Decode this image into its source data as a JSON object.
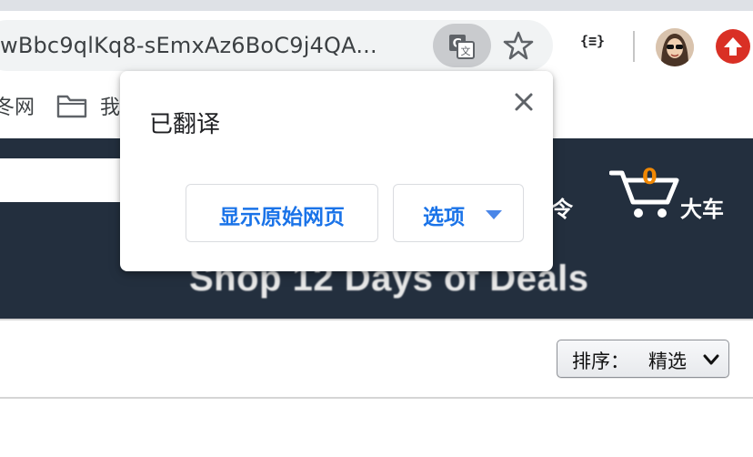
{
  "browser": {
    "url_text": "wBbc9qlKq8-sEmxAz6BoC9j4QA...",
    "extension_label": "{≡}",
    "icons": [
      "translate-icon",
      "star-icon",
      "extension-icon",
      "avatar",
      "update-icon"
    ]
  },
  "bookmarks": {
    "item1_label": "冬网",
    "item2_label": "我"
  },
  "site": {
    "header_partial": "令",
    "cart_count": "0",
    "cart_label": "大车",
    "banner": "Shop 12 Days of Deals",
    "sort_label": "排序：",
    "sort_value": "精选"
  },
  "translate_bubble": {
    "title": "已翻译",
    "show_original_label": "显示原始网页",
    "options_label": "选项"
  },
  "colors": {
    "header_bg": "#232f3e",
    "accent_blue": "#1a73e8",
    "cart_orange": "#f08804",
    "update_red": "#d93025"
  }
}
